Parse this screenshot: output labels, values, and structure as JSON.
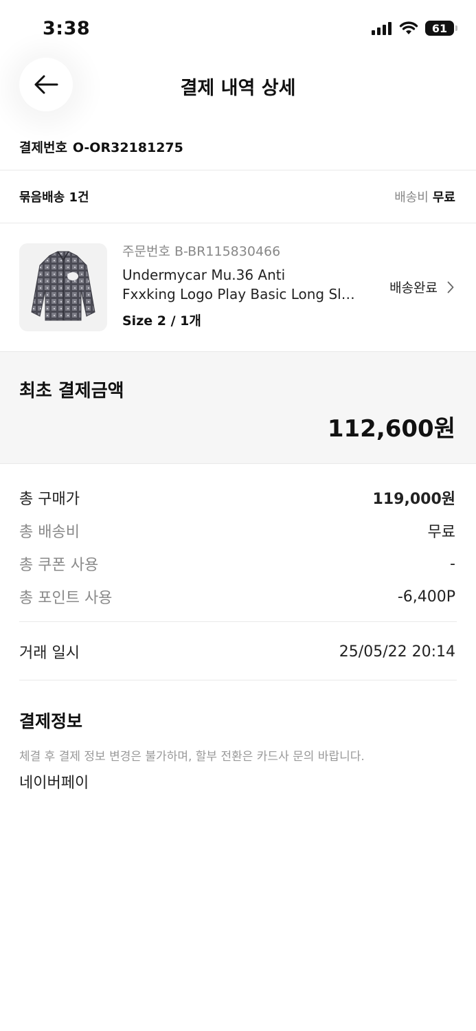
{
  "status_bar": {
    "time": "3:38",
    "battery": "61"
  },
  "header": {
    "title": "결제 내역 상세",
    "back_icon": "arrow-left-icon"
  },
  "payment_number": {
    "label": "결제번호",
    "value": "O-OR32181275"
  },
  "bundle": {
    "label": "묶음배송 1건",
    "fee_label": "배송비",
    "fee_value": "무료"
  },
  "product": {
    "order_no": "주문번호 B-BR115830466",
    "name_line1": "Undermycar Mu.36 Anti",
    "name_line2": "Fxxking Logo Play Basic Long Sleeve Shirt",
    "size": "Size 2 / 1개",
    "status": "배송완료"
  },
  "first_payment": {
    "label": "최초 결제금액",
    "amount": "112,600원"
  },
  "summary": [
    {
      "label": "총 구매가",
      "value": "119,000원"
    },
    {
      "label": "총 배송비",
      "value": "무료"
    },
    {
      "label": "총 쿠폰 사용",
      "value": "-"
    },
    {
      "label": "총 포인트 사용",
      "value": "-6,400P"
    }
  ],
  "transaction": {
    "label": "거래 일시",
    "value": "25/05/22 20:14"
  },
  "payment_info": {
    "title": "결제정보",
    "notice": "체결 후 결제 정보 변경은 불가하며, 할부 전환은 카드사 문의 바랍니다.",
    "method": "네이버페이"
  },
  "colors": {
    "text": "#111111",
    "muted": "#888888",
    "section_bg": "#f6f6f6",
    "divider": "#e9e9e9"
  }
}
